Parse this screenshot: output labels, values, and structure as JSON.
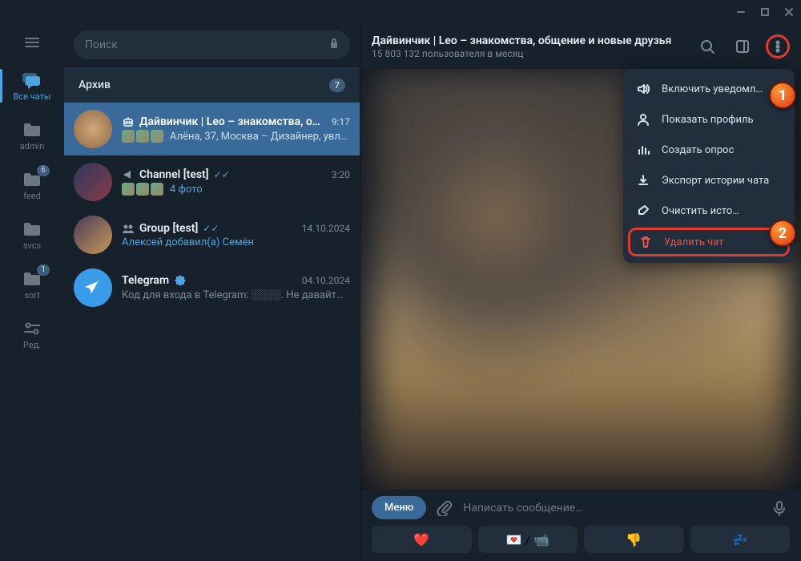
{
  "search_placeholder": "Поиск",
  "folders": [
    {
      "key": "allchats",
      "label": "Все чаты"
    },
    {
      "key": "admin",
      "label": "admin"
    },
    {
      "key": "feed",
      "label": "feed",
      "badge": "6"
    },
    {
      "key": "svcs",
      "label": "svcs"
    },
    {
      "key": "sort",
      "label": "sort",
      "badge": "1"
    },
    {
      "key": "edit",
      "label": "Ред."
    }
  ],
  "archive": {
    "label": "Архив",
    "badge": "7"
  },
  "chats": [
    {
      "name": "Дайвинчик | Leo – знакомства, о…",
      "time": "9:17",
      "preview": "Алёна, 37, Москва – Дизайнер, увл…",
      "type": "bot",
      "selected": true,
      "thumbs": 3
    },
    {
      "name": "Channel [test]",
      "time": "3:20",
      "preview": "4 фото",
      "type": "channel",
      "checks": true,
      "thumbs": 3,
      "accent": true
    },
    {
      "name": "Group [test]",
      "time": "14.10.2024",
      "preview": "Алексей добавил(а) Семён",
      "type": "group",
      "checks": true,
      "accent": true
    },
    {
      "name": "Telegram",
      "time": "04.10.2024",
      "preview": "Код для входа в Telegram: ░░░░. Не давайт…",
      "type": "service",
      "verified": true
    }
  ],
  "header": {
    "title": "Дайвинчик | Leo – знакомства, общение и новые друзья",
    "subtitle": "15 803 132 пользователя в месяц"
  },
  "menu": [
    {
      "icon": "unmute",
      "label": "Включить уведомл…"
    },
    {
      "icon": "profile",
      "label": "Показать профиль"
    },
    {
      "icon": "poll",
      "label": "Создать опрос"
    },
    {
      "icon": "export",
      "label": "Экспорт истории чата"
    },
    {
      "icon": "clear",
      "label": "Очистить исто…"
    },
    {
      "icon": "delete",
      "label": "Удалить чат",
      "danger": true
    }
  ],
  "composer": {
    "menu": "Меню",
    "placeholder": "Написать сообщение…"
  },
  "reactions": [
    "❤️",
    "💌 / 📹",
    "👎",
    "💤"
  ],
  "callouts": {
    "one": "1",
    "two": "2"
  }
}
